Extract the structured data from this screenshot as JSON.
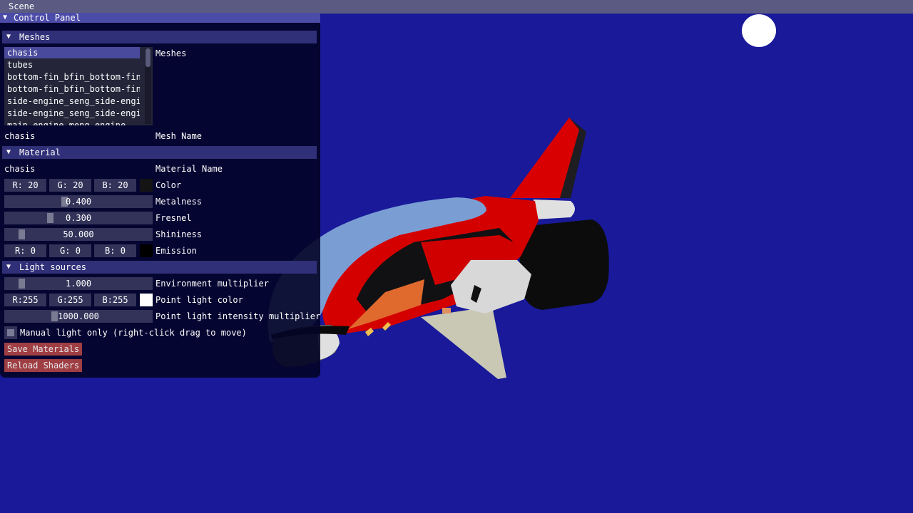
{
  "menubar": {
    "scene_label": "Scene"
  },
  "panel": {
    "title": "Control Panel",
    "meshes": {
      "header": "Meshes",
      "list_label": "Meshes",
      "items": [
        "chasis",
        "tubes",
        "bottom-fin_bfin_bottom-fin-",
        "bottom-fin_bfin_bottom-fin",
        "side-engine_seng_side-engir",
        "side-engine_seng_side-engir",
        "main-engine_meng_engine"
      ],
      "selected_index": 0,
      "mesh_name_value": "chasis",
      "mesh_name_label": "Mesh Name"
    },
    "material": {
      "header": "Material",
      "name_value": "chasis",
      "name_label": "Material Name",
      "color": {
        "r": "R: 20",
        "g": "G: 20",
        "b": "B: 20",
        "swatch": "#141414",
        "label": "Color"
      },
      "metalness": {
        "value": "0.400",
        "fraction": 0.4,
        "label": "Metalness"
      },
      "fresnel": {
        "value": "0.300",
        "fraction": 0.3,
        "label": "Fresnel"
      },
      "shininess": {
        "value": "50.000",
        "fraction": 0.1,
        "label": "Shininess"
      },
      "emission": {
        "r": "R: 0",
        "g": "G: 0",
        "b": "B: 0",
        "swatch": "#000000",
        "label": "Emission"
      }
    },
    "lights": {
      "header": "Light sources",
      "env_mult": {
        "value": "1.000",
        "fraction": 0.1,
        "label": "Environment multiplier"
      },
      "point_color": {
        "r": "R:255",
        "g": "G:255",
        "b": "B:255",
        "swatch": "#ffffff",
        "label": "Point light color"
      },
      "intensity": {
        "value": "1000.000",
        "fraction": 0.33,
        "label": "Point light intensity multiplier"
      },
      "manual_only_label": "Manual light only (right-click drag to move)"
    },
    "buttons": {
      "save": "Save Materials",
      "reload": "Reload Shaders"
    }
  },
  "colors": {
    "background": "#19199a",
    "accent": "#4b4ba8"
  }
}
